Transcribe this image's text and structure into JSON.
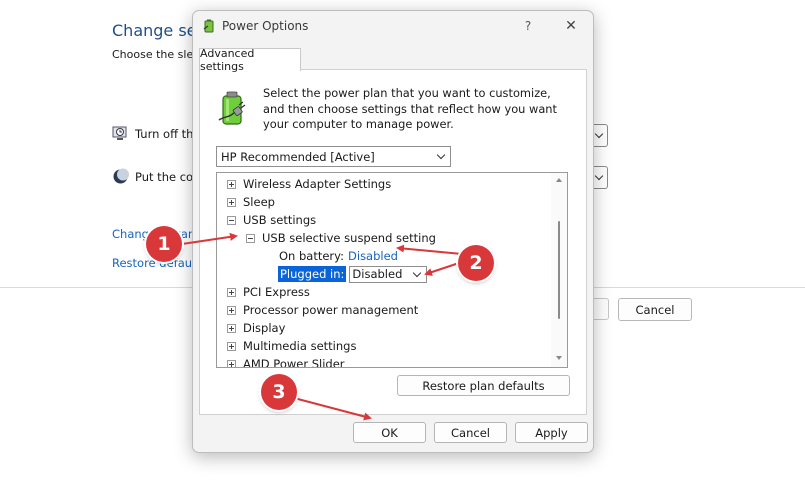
{
  "background_window": {
    "title": "Change settings for the plan: HP Recommended",
    "subtitle": "Choose the sleep and display settings that you want your computer to use.",
    "rows": [
      {
        "label": "Turn off the display:",
        "icon": "display-timer-icon"
      },
      {
        "label": "Put the computer to sleep:",
        "icon": "sleep-moon-icon"
      }
    ],
    "links": [
      "Change advanced power settings",
      "Restore default settings for this plan"
    ],
    "cancel_label": "Cancel"
  },
  "dialog": {
    "title": "Power Options",
    "help_glyph": "?",
    "close_glyph": "✕",
    "tab_label": "Advanced settings",
    "description": "Select the power plan that you want to customize, and then choose settings that reflect how you want your computer to manage power.",
    "plan_selected": "HP Recommended [Active]",
    "tree": {
      "items": [
        {
          "label": "Wireless Adapter Settings",
          "expanded": false
        },
        {
          "label": "Sleep",
          "expanded": false
        },
        {
          "label": "USB settings",
          "expanded": true
        },
        {
          "label": "USB selective suspend setting",
          "expanded": true
        },
        {
          "label": "PCI Express",
          "expanded": false
        },
        {
          "label": "Processor power management",
          "expanded": false
        },
        {
          "label": "Display",
          "expanded": false
        },
        {
          "label": "Multimedia settings",
          "expanded": false
        },
        {
          "label": "AMD Power Slider",
          "expanded": false
        }
      ],
      "on_battery_label": "On battery:",
      "on_battery_value": "Disabled",
      "plugged_in_label": "Plugged in:",
      "plugged_in_value": "Disabled"
    },
    "restore_label": "Restore plan defaults",
    "buttons": {
      "ok": "OK",
      "cancel": "Cancel",
      "apply": "Apply"
    }
  },
  "annotations": {
    "markers": [
      "1",
      "2",
      "3"
    ],
    "color": "#d9383a"
  }
}
